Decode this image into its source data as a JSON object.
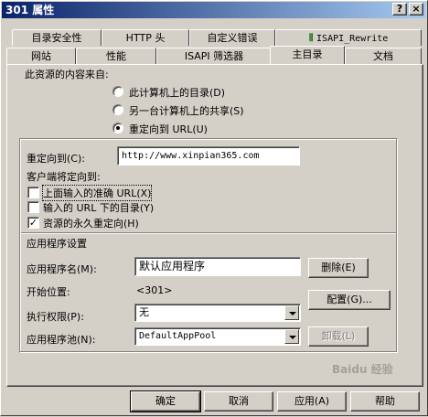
{
  "window": {
    "title": "301 属性",
    "help_btn": "?",
    "close_btn": "×"
  },
  "tabs_row1": [
    {
      "label": "目录安全性"
    },
    {
      "label": "HTTP 头"
    },
    {
      "label": "自定义错误"
    },
    {
      "label": "ISAPI_Rewrite"
    }
  ],
  "tabs_row2": [
    {
      "label": "网站"
    },
    {
      "label": "性能"
    },
    {
      "label": "ISAPI 筛选器"
    },
    {
      "label": "主目录"
    },
    {
      "label": "文档"
    }
  ],
  "source": {
    "heading": "此资源的内容来自:",
    "options": [
      {
        "label": "此计算机上的目录(D)",
        "checked": false
      },
      {
        "label": "另一台计算机上的共享(S)",
        "checked": false
      },
      {
        "label": "重定向到 URL(U)",
        "checked": true
      }
    ]
  },
  "redirect": {
    "label": "重定向到(C):",
    "value": "http://www.xinpian365.com",
    "client_heading": "客户端将定向到:",
    "checks": [
      {
        "label": "上面输入的准确 URL(X)",
        "checked": false
      },
      {
        "label": "输入的 URL 下的目录(Y)",
        "checked": false
      },
      {
        "label": "资源的永久重定向(H)",
        "checked": true
      }
    ]
  },
  "app": {
    "heading": "应用程序设置",
    "name_label": "应用程序名(M):",
    "name_value": "默认应用程序",
    "remove_btn": "删除(E)",
    "start_label": "开始位置:",
    "start_value": "<301>",
    "config_btn": "配置(G)...",
    "perm_label": "执行权限(P):",
    "perm_value": "无",
    "pool_label": "应用程序池(N):",
    "pool_value": "DefaultAppPool",
    "unload_btn": "卸载(L)"
  },
  "footer": {
    "ok": "确定",
    "cancel": "取消",
    "apply": "应用(A)",
    "help": "帮助"
  }
}
